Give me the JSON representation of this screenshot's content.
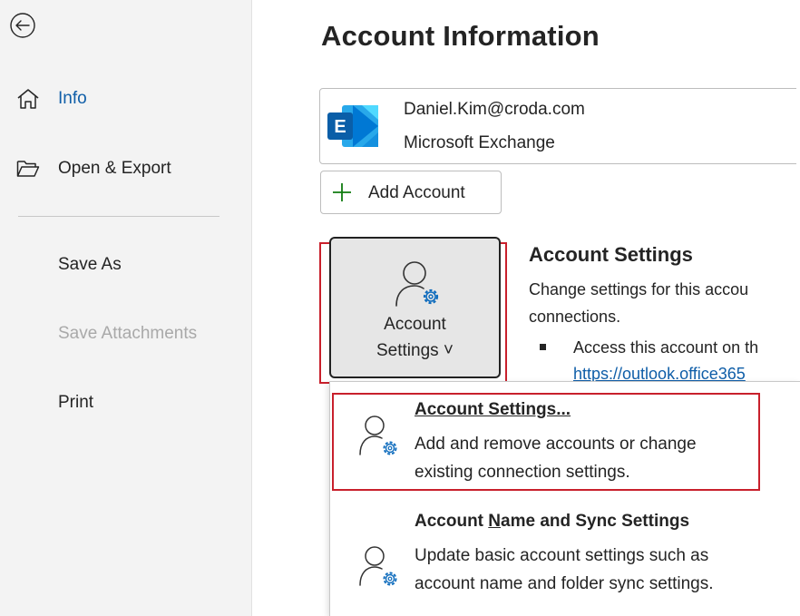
{
  "nav": {
    "items": [
      {
        "label": "Info",
        "icon": "home-icon",
        "state": "active"
      },
      {
        "label": "Open & Export",
        "icon": "folder-open-icon",
        "state": "normal"
      },
      {
        "label": "Save As",
        "state": "normal"
      },
      {
        "label": "Save Attachments",
        "state": "disabled"
      },
      {
        "label": "Print",
        "state": "normal"
      }
    ],
    "back_icon": "back-arrow-icon"
  },
  "main": {
    "title": "Account Information",
    "account": {
      "email": "Daniel.Kim@croda.com",
      "type": "Microsoft Exchange",
      "icon": "exchange-logo-icon"
    },
    "add_account_label": "Add Account",
    "settings_button": {
      "line1": "Account",
      "line2": "Settings ˅"
    },
    "settings_section": {
      "title": "Account Settings",
      "desc_line1": "Change settings for this accou",
      "desc_line2": "connections.",
      "bullet": "Access this account on th",
      "link": "https://outlook.office365"
    }
  },
  "dropdown": {
    "items": [
      {
        "title": "Account Settings...",
        "desc_line1": "Add and remove accounts or change",
        "desc_line2": "existing connection settings."
      },
      {
        "title_pre": "Account ",
        "title_underlined": "N",
        "title_post": "ame and Sync Settings",
        "desc_line1": "Update basic account settings such as",
        "desc_line2": "account name and folder sync settings."
      }
    ]
  },
  "colors": {
    "accent": "#0f5ea8",
    "highlight_outline": "#c8202c",
    "nav_bg": "#f3f3f3",
    "button_bg": "#e6e6e6"
  }
}
